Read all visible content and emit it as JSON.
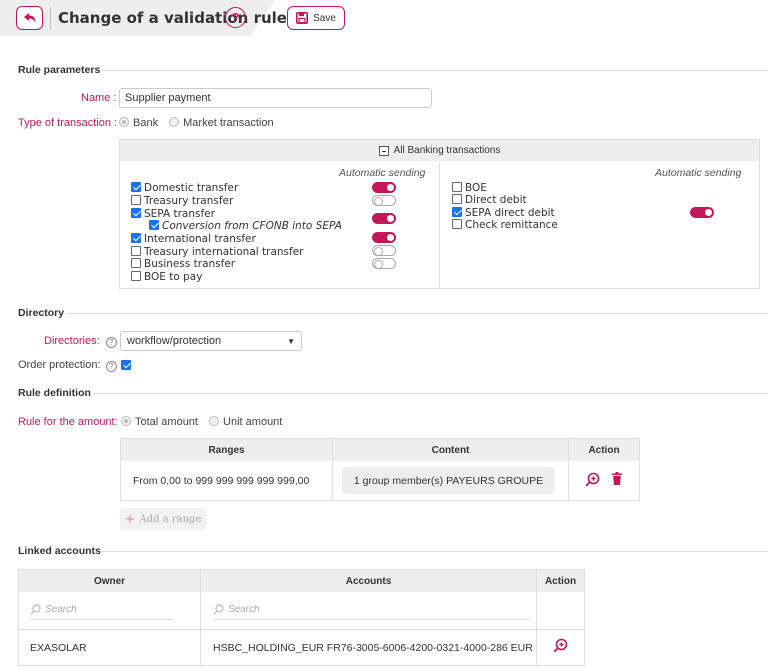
{
  "header": {
    "title": "Change of a validation rule",
    "help": "?",
    "save_label": "Save"
  },
  "rule_params": {
    "section": "Rule parameters",
    "name_label": "Name :",
    "name_value": "Supplier payment",
    "type_label": "Type of transaction :",
    "type_options": [
      "Bank",
      "Market transaction"
    ],
    "all_banking": "All Banking transactions",
    "auto_sending": "Automatic sending",
    "left_items": [
      {
        "label": "Domestic transfer",
        "checked": true,
        "toggle": "on"
      },
      {
        "label": "Treasury transfer",
        "checked": false,
        "toggle": "off"
      },
      {
        "label": "SEPA transfer",
        "checked": true,
        "toggle": "on"
      },
      {
        "label": "Conversion from CFONB into SEPA",
        "checked": true,
        "toggle": null
      },
      {
        "label": "International transfer",
        "checked": true,
        "toggle": "on"
      },
      {
        "label": "Treasury international transfer",
        "checked": false,
        "toggle": "off"
      },
      {
        "label": "Business transfer",
        "checked": false,
        "toggle": "off"
      },
      {
        "label": "BOE to pay",
        "checked": false,
        "toggle": null
      }
    ],
    "right_items": [
      {
        "label": "BOE",
        "checked": false
      },
      {
        "label": "Direct debit",
        "checked": false
      },
      {
        "label": "SEPA direct debit",
        "checked": true,
        "toggle": "on"
      },
      {
        "label": "Check remittance",
        "checked": false
      }
    ]
  },
  "directory": {
    "section": "Directory",
    "directories_label": "Directories:",
    "directories_value": "workflow/protection",
    "order_label": "Order protection:"
  },
  "rule_def": {
    "section": "Rule definition",
    "amount_label": "Rule for the amount:",
    "amount_options": [
      "Total amount",
      "Unit amount"
    ],
    "headers": [
      "Ranges",
      "Content",
      "Action"
    ],
    "row": {
      "range": "From 0,00 to 999 999 999 999 999,00",
      "content": "1 group member(s) PAYEURS GROUPE"
    },
    "add_range": "Add a range"
  },
  "linked": {
    "section": "Linked accounts",
    "headers": [
      "Owner",
      "Accounts",
      "Action"
    ],
    "search_placeholder": "Search",
    "row": {
      "owner": "EXASOLAR",
      "account": "HSBC_HOLDING_EUR FR76-3005-6006-4200-0321-4000-286 EUR"
    }
  },
  "colors": {
    "accent": "#c2185b",
    "check": "#1a73e8"
  }
}
